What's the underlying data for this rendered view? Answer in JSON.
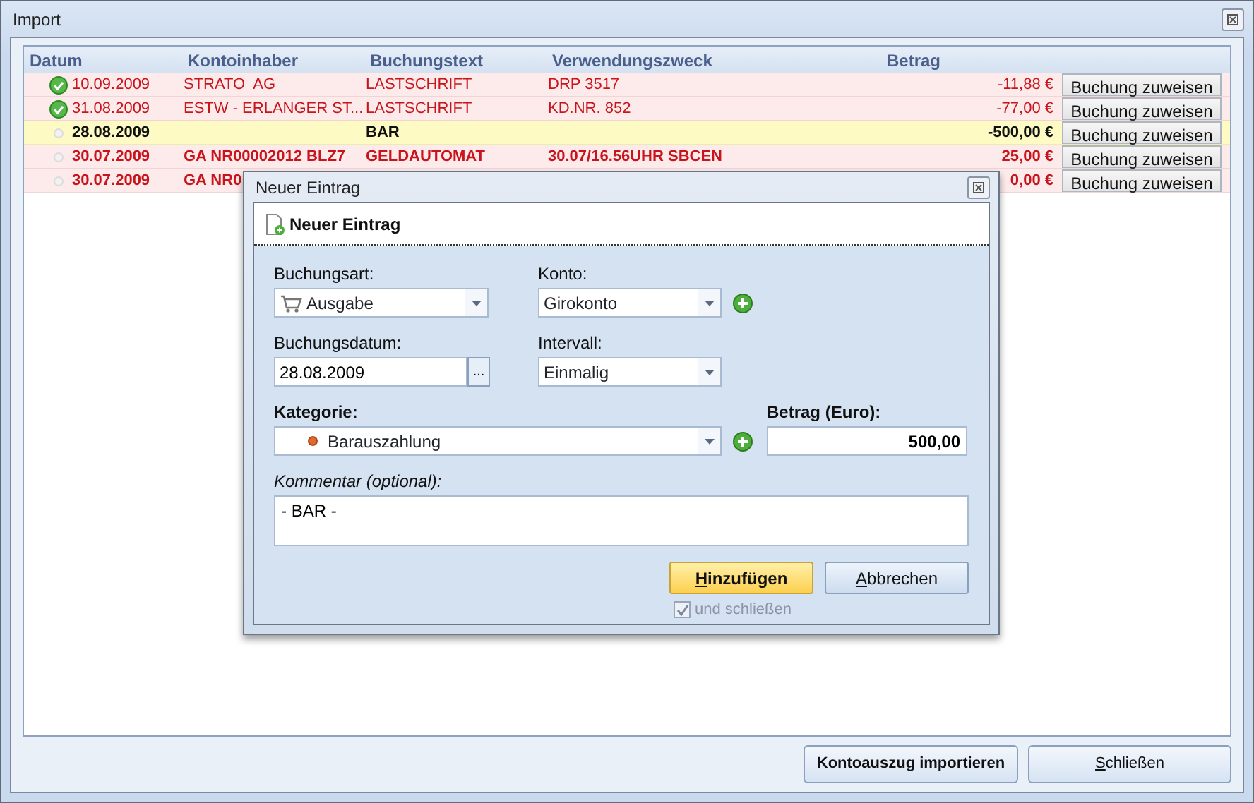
{
  "window": {
    "title": "Import"
  },
  "table": {
    "columns": [
      "Datum",
      "Kontoinhaber",
      "Buchungstext",
      "Verwendungszweck",
      "Betrag"
    ],
    "rows": [
      {
        "kind": "assigned",
        "selected": false,
        "date": "10.09.2009",
        "account_holder": "STRATO  AG",
        "booking_text": "LASTSCHRIFT",
        "purpose": "DRP 3517",
        "amount": "-11,88 €",
        "action": "Buchung zuweisen"
      },
      {
        "kind": "assigned",
        "selected": false,
        "date": "31.08.2009",
        "account_holder": "ESTW - ERLANGER ST...",
        "booking_text": "LASTSCHRIFT",
        "purpose": "KD.NR. 852",
        "amount": "-77,00 €",
        "action": "Buchung zuweisen"
      },
      {
        "kind": "unassigned",
        "selected": true,
        "date": "28.08.2009",
        "booking_text": "BAR",
        "amount": "-500,00 €",
        "action": "Buchung zuweisen"
      },
      {
        "kind": "unassigned",
        "selected": false,
        "date": "30.07.2009",
        "account_holder": "GA NR00002012 BLZ7",
        "booking_text": "GELDAUTOMAT",
        "purpose": "30.07/16.56UHR SBCEN",
        "amount": "25,00 €",
        "action": "Buchung zuweisen"
      },
      {
        "kind": "unassigned",
        "selected": false,
        "date": "30.07.2009",
        "account_holder": "GA NR0",
        "amount": "0,00 €",
        "action": "Buchung zuweisen"
      }
    ]
  },
  "buttons": [
    {
      "label": "Kontoauszug importieren",
      "default": true,
      "mnemonic": false
    },
    {
      "label": "Schließen",
      "default": false,
      "mnemonic": true
    }
  ],
  "dialog": {
    "title": "Neuer Eintrag",
    "header": "Neuer Eintrag",
    "booking_type": {
      "label": "Buchungsart:",
      "value": "Ausgabe"
    },
    "account": {
      "label": "Konto:",
      "value": "Girokonto"
    },
    "booking_date": {
      "label": "Buchungsdatum:",
      "value": "28.08.2009",
      "picker": "..."
    },
    "interval": {
      "label": "Intervall:",
      "value": "Einmalig"
    },
    "category": {
      "label": "Kategorie:",
      "value": "Barauszahlung"
    },
    "amount": {
      "label": "Betrag (Euro):",
      "value": "500,00"
    },
    "comment": {
      "label": "Kommentar (optional):",
      "value": "- BAR -"
    },
    "buttons": [
      {
        "label": "Hinzufügen",
        "primary": true,
        "mnemonic": true
      },
      {
        "label": "Abbrechen",
        "primary": false,
        "mnemonic": true
      }
    ],
    "close_checkbox": {
      "label": "und schließen",
      "checked": true,
      "disabled": true
    }
  }
}
